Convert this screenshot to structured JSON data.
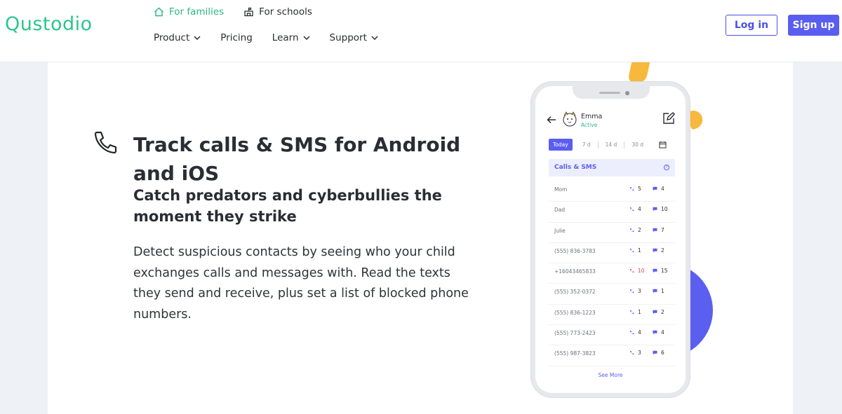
{
  "brand": {
    "logo": "Qustodio",
    "accent": "#2cc58e",
    "primary": "#5a5ef0"
  },
  "topnav": {
    "families": "For families",
    "schools": "For schools"
  },
  "mainnav": {
    "product": "Product",
    "pricing": "Pricing",
    "learn": "Learn",
    "support": "Support"
  },
  "auth": {
    "login": "Log in",
    "signup": "Sign up"
  },
  "feature": {
    "title": "Track calls & SMS for Android and iOS",
    "subtitle": "Catch predators and cyberbullies the moment they strike",
    "description": "Detect suspicious contacts by seeing who your child exchanges calls and messages with. Read the texts they send and receive, plus set a list of blocked phone numbers."
  },
  "phone": {
    "user_name": "Emma",
    "user_status": "Active",
    "tabs": [
      "Today",
      "7 d",
      "14 d",
      "30 d"
    ],
    "section_title": "Calls & SMS",
    "rows": [
      {
        "name": "Mom",
        "calls": "5",
        "sms": "4",
        "blocked": false
      },
      {
        "name": "Dad",
        "calls": "4",
        "sms": "10",
        "blocked": false
      },
      {
        "name": "Julie",
        "calls": "2",
        "sms": "7",
        "blocked": false
      },
      {
        "name": "(555) 836-3783",
        "calls": "1",
        "sms": "2",
        "blocked": false
      },
      {
        "name": "+16043465833",
        "calls": "10",
        "sms": "15",
        "blocked": true
      },
      {
        "name": "(555) 352-0372",
        "calls": "3",
        "sms": "1",
        "blocked": false
      },
      {
        "name": "(555) 836-1223",
        "calls": "1",
        "sms": "2",
        "blocked": false
      },
      {
        "name": "(555) 773-2423",
        "calls": "4",
        "sms": "4",
        "blocked": false
      },
      {
        "name": "(555) 987-3823",
        "calls": "3",
        "sms": "6",
        "blocked": false
      }
    ],
    "see_more": "See More"
  }
}
